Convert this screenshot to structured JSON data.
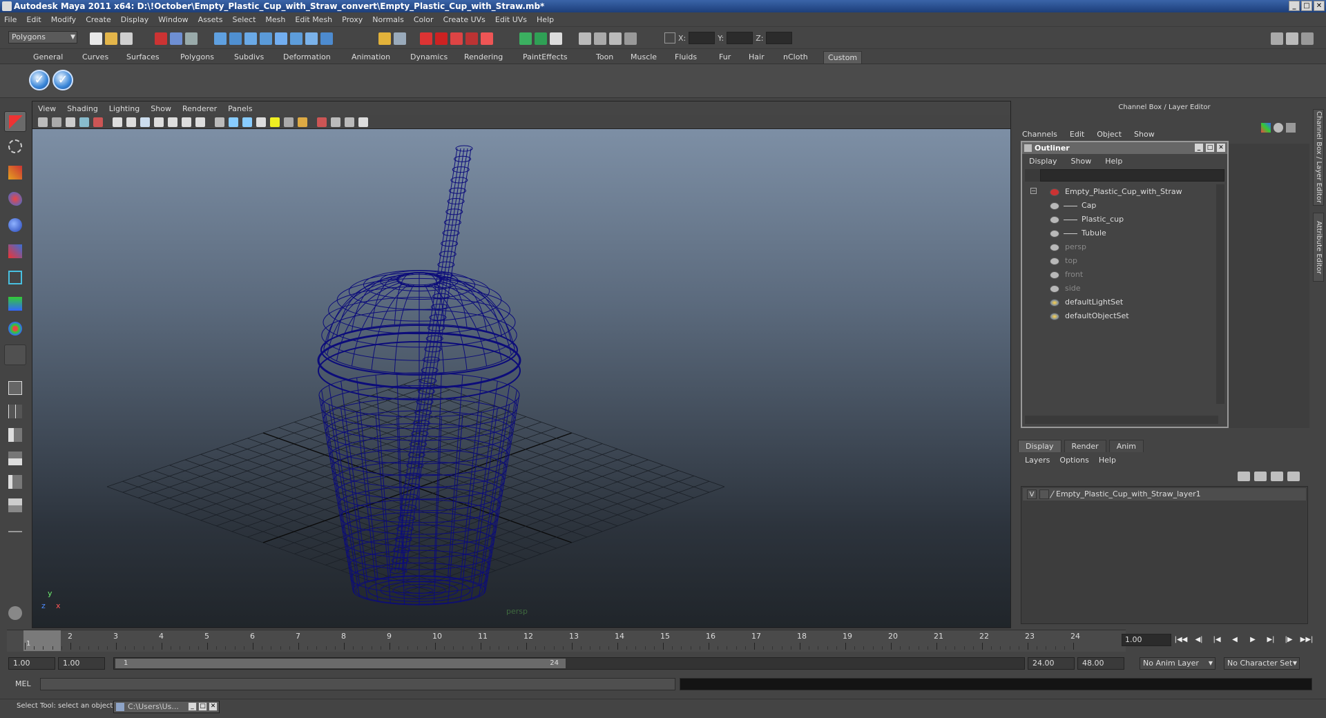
{
  "window": {
    "title": "Autodesk Maya 2011 x64: D:\\!October\\Empty_Plastic_Cup_with_Straw_convert\\Empty_Plastic_Cup_with_Straw.mb*",
    "minimize": "_",
    "maximize": "□",
    "close": "✕"
  },
  "menubar": [
    "File",
    "Edit",
    "Modify",
    "Create",
    "Display",
    "Window",
    "Assets",
    "Select",
    "Mesh",
    "Edit Mesh",
    "Proxy",
    "Normals",
    "Color",
    "Create UVs",
    "Edit UVs",
    "Help"
  ],
  "statusline": {
    "mode": "Polygons",
    "x_label": "X:",
    "y_label": "Y:",
    "z_label": "Z:"
  },
  "shelf": {
    "tabs": [
      "General",
      "Curves",
      "Surfaces",
      "Polygons",
      "Subdivs",
      "Deformation",
      "Animation",
      "Dynamics",
      "Rendering",
      "PaintEffects",
      "Toon",
      "Muscle",
      "Fluids",
      "Fur",
      "Hair",
      "nCloth",
      "Custom"
    ],
    "active_tab": "Custom",
    "check_glyph": "✓"
  },
  "viewport": {
    "menu": [
      "View",
      "Shading",
      "Lighting",
      "Show",
      "Renderer",
      "Panels"
    ],
    "camera": "persp",
    "axis_x": "x",
    "axis_y": "y",
    "axis_z": "z",
    "wire_color": "#0c0c7a",
    "grid_color": "#1a1f26"
  },
  "channel_box": {
    "title": "Channel Box / Layer Editor",
    "menu": [
      "Channels",
      "Edit",
      "Object",
      "Show"
    ],
    "side_tabs": [
      "Channel Box / Layer Editor",
      "Attribute Editor"
    ]
  },
  "outliner": {
    "title": "Outliner",
    "menu": [
      "Display",
      "Show",
      "Help"
    ],
    "items": [
      {
        "label": "Empty_Plastic_Cup_with_Straw",
        "indent": 0,
        "dim": false,
        "icon": "transform-icon"
      },
      {
        "label": "Cap",
        "indent": 1,
        "dim": false,
        "icon": "mesh-icon"
      },
      {
        "label": "Plastic_cup",
        "indent": 1,
        "dim": false,
        "icon": "mesh-icon"
      },
      {
        "label": "Tubule",
        "indent": 1,
        "dim": false,
        "icon": "mesh-icon"
      },
      {
        "label": "persp",
        "indent": 0,
        "dim": true,
        "icon": "camera-icon"
      },
      {
        "label": "top",
        "indent": 0,
        "dim": true,
        "icon": "camera-icon"
      },
      {
        "label": "front",
        "indent": 0,
        "dim": true,
        "icon": "camera-icon"
      },
      {
        "label": "side",
        "indent": 0,
        "dim": true,
        "icon": "camera-icon"
      },
      {
        "label": "defaultLightSet",
        "indent": 0,
        "dim": false,
        "icon": "set-icon"
      },
      {
        "label": "defaultObjectSet",
        "indent": 0,
        "dim": false,
        "icon": "set-icon"
      }
    ]
  },
  "layer_editor": {
    "tabs": [
      "Display",
      "Render",
      "Anim"
    ],
    "active_tab": "Display",
    "menu": [
      "Layers",
      "Options",
      "Help"
    ],
    "layers": [
      {
        "visible": "V",
        "name": "Empty_Plastic_Cup_with_Straw_layer1"
      }
    ]
  },
  "timeline": {
    "ticks": [
      "1",
      "2",
      "3",
      "4",
      "5",
      "6",
      "7",
      "8",
      "9",
      "10",
      "11",
      "12",
      "13",
      "14",
      "15",
      "16",
      "17",
      "18",
      "19",
      "20",
      "21",
      "22",
      "23",
      "24"
    ],
    "current_marker": "1",
    "current_frame": "1.00",
    "playback_buttons": [
      "|◀◀",
      "◀|",
      "|◀",
      "◀",
      "▶",
      "▶|",
      "|▶",
      "▶▶|"
    ]
  },
  "range": {
    "start_time": "1.00",
    "playback_start": "1.00",
    "slider_start": "1",
    "slider_end": "24",
    "playback_end": "24.00",
    "end_time": "48.00",
    "anim_layer": "No Anim Layer",
    "character_set": "No Character Set"
  },
  "command_line": {
    "label": "MEL"
  },
  "help_line": {
    "text": "Select Tool: select an object",
    "taskbar_item": "C:\\Users\\Us..."
  }
}
